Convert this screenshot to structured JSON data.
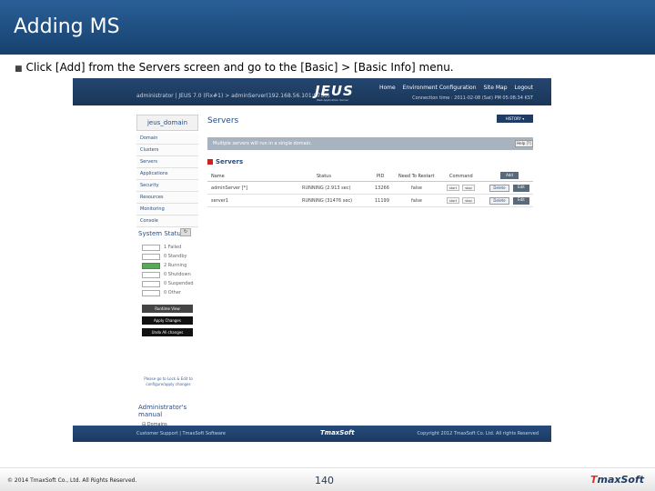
{
  "slide": {
    "title": "Adding MS",
    "instruction": "Click [Add] from the Servers screen and go to the [Basic] > [Basic Info] menu.",
    "copyright": "© 2014 TmaxSoft Co., Ltd. All Rights Reserved.",
    "page_number": "140",
    "logo_prefix": "T",
    "logo_text": "maxSoft"
  },
  "app": {
    "logo": "JEUS",
    "logo_sub": "Web Application Server",
    "user_line": "administrator  |  JEUS 7.0 (Fix#1)  >  adminServer(192.168.56.101:9736)",
    "top_nav": [
      "Home",
      "Environment Configuration",
      "Site Map",
      "Logout"
    ],
    "connection": "Connection time : 2011-02-08 (Sat) PM 05:08:34 KST"
  },
  "sidebar": {
    "domain": "jeus_domain",
    "items": [
      "Domain",
      "Clusters",
      "Servers",
      "Applications",
      "Security",
      "Resources",
      "Monitoring",
      "Console"
    ],
    "status_title": "System Status",
    "status_rows": [
      {
        "count": "1",
        "label": "Failed",
        "on": false
      },
      {
        "count": "0",
        "label": "Standby",
        "on": false
      },
      {
        "count": "2",
        "label": "Running",
        "on": true
      },
      {
        "count": "0",
        "label": "Shutdown",
        "on": false
      },
      {
        "count": "0",
        "label": "Suspended",
        "on": false
      },
      {
        "count": "0",
        "label": "Other",
        "on": false
      }
    ],
    "buttons": [
      "Runtime View",
      "Apply Changes",
      "Undo All changes"
    ],
    "note": "Please go to Lock & Edit to configure/apply changes",
    "manual_title": "Administrator's manual",
    "manual_links": [
      "Domains",
      "Servers"
    ],
    "see_more": "See more"
  },
  "main": {
    "title": "Servers",
    "history_label": "HISTORY ▾",
    "help_label": "Help [?]",
    "info_text": "Multiple servers will run in a single domain.",
    "section_title": "Servers",
    "columns": [
      "Name",
      "Status",
      "PID",
      "Need To Restart",
      "Command"
    ],
    "add_label": "Add",
    "rows": [
      {
        "name": "adminServer [*]",
        "status": "RUNNING (2.913 sec)",
        "pid": "13266",
        "restart": "false",
        "start": "start",
        "stop": "stop",
        "delete": "Delete",
        "edit": "Edit"
      },
      {
        "name": "server1",
        "status": "RUNNING (31476 sec)",
        "pid": "11199",
        "restart": "false",
        "start": "start",
        "stop": "stop",
        "delete": "Delete",
        "edit": "Edit"
      }
    ]
  },
  "footer": {
    "left": "Customer Support  |  TmaxSoft Software",
    "logo": "TmaxSoft",
    "right": "Copyright 2012 TmaxSoft Co. Ltd. All rights Reserved"
  },
  "colors": {
    "header_blue": "#1e4a7a",
    "link_blue": "#274d80",
    "running_green": "#5aa65a"
  }
}
